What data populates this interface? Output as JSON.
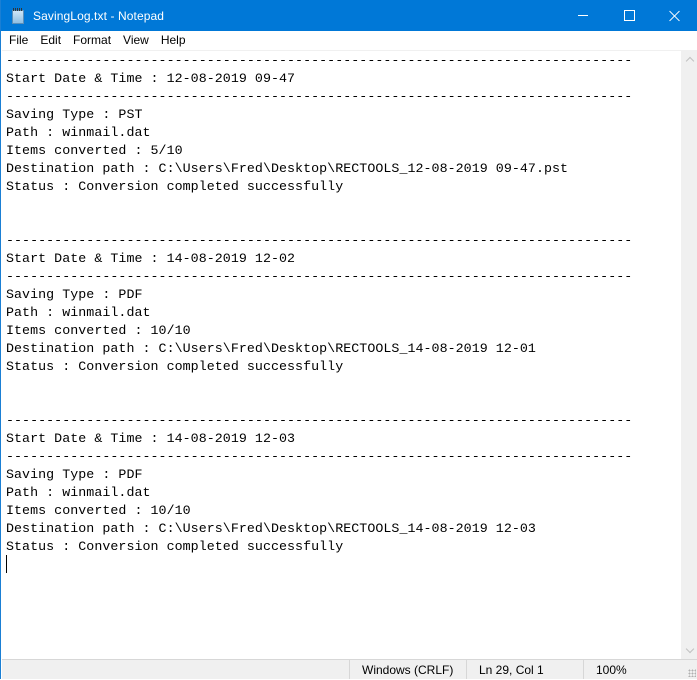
{
  "window": {
    "title": "SavingLog.txt - Notepad",
    "app_icon": "notepad-icon",
    "accent_color": "#0078d7",
    "caption_buttons": [
      {
        "name": "minimize",
        "icon": "minimize-icon"
      },
      {
        "name": "maximize",
        "icon": "maximize-icon"
      },
      {
        "name": "close",
        "icon": "close-icon"
      }
    ]
  },
  "menu": {
    "items": [
      {
        "label": "File"
      },
      {
        "label": "Edit"
      },
      {
        "label": "Format"
      },
      {
        "label": "View"
      },
      {
        "label": "Help"
      }
    ]
  },
  "editor": {
    "lines": [
      "------------------------------------------------------------------------------",
      "Start Date & Time : 12-08-2019 09-47",
      "------------------------------------------------------------------------------",
      "Saving Type : PST",
      "Path : winmail.dat",
      "Items converted : 5/10",
      "Destination path : C:\\Users\\Fred\\Desktop\\RECTOOLS_12-08-2019 09-47.pst",
      "Status : Conversion completed successfully",
      "",
      "",
      "------------------------------------------------------------------------------",
      "Start Date & Time : 14-08-2019 12-02",
      "------------------------------------------------------------------------------",
      "Saving Type : PDF",
      "Path : winmail.dat",
      "Items converted : 10/10",
      "Destination path : C:\\Users\\Fred\\Desktop\\RECTOOLS_14-08-2019 12-01",
      "Status : Conversion completed successfully",
      "",
      "",
      "------------------------------------------------------------------------------",
      "Start Date & Time : 14-08-2019 12-03",
      "------------------------------------------------------------------------------",
      "Saving Type : PDF",
      "Path : winmail.dat",
      "Items converted : 10/10",
      "Destination path : C:\\Users\\Fred\\Desktop\\RECTOOLS_14-08-2019 12-03",
      "Status : Conversion completed successfully",
      ""
    ]
  },
  "statusbar": {
    "line_ending": "Windows (CRLF)",
    "cursor_position": "Ln 29, Col 1",
    "zoom": "100%"
  }
}
